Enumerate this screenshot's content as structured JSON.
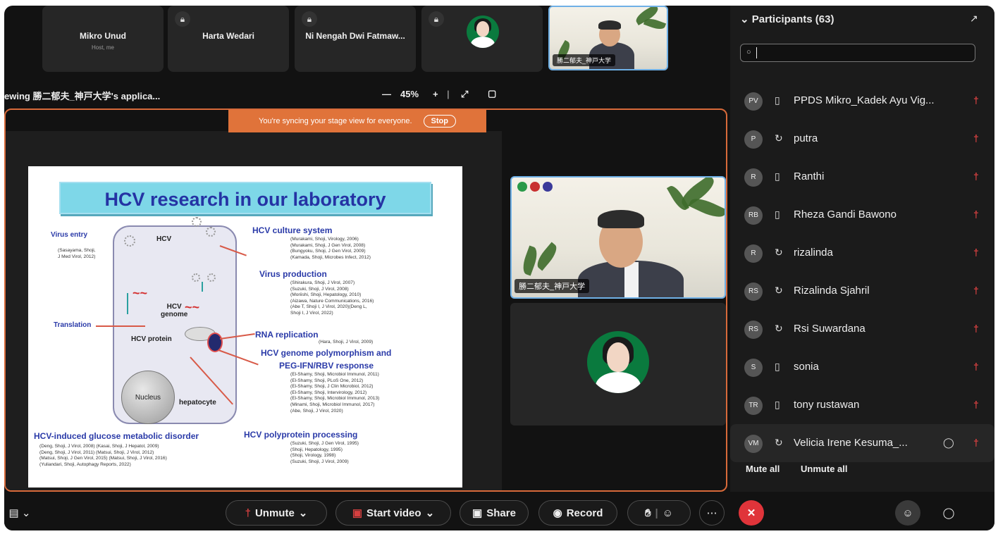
{
  "top_tiles": [
    {
      "name": "Mikro Unud",
      "sub": "Host, me"
    },
    {
      "name": "Harta Wedari"
    },
    {
      "name": "Ni Nengah Dwi Fatmaw..."
    }
  ],
  "speaker_label": "勝二郁夫_神戸大学",
  "share_bar": {
    "text": "ewing 勝二郁夫_神戸大学's applica...",
    "zoom_minus": "—",
    "zoom": "45%",
    "zoom_plus": "+"
  },
  "sync_banner": {
    "text": "You're syncing your stage view for everyone.",
    "stop": "Stop"
  },
  "slide": {
    "title": "HCV research in our laboratory",
    "labels": {
      "virus_entry": "Virus entry",
      "hcv": "HCV",
      "translation": "Translation",
      "hcv_genome": "HCV\ngenome",
      "hcv_protein": "HCV protein",
      "nucleus": "Nucleus",
      "hepatocyte": "hepatocyte",
      "glucose": "HCV-induced glucose metabolic disorder"
    },
    "entry_refs": "(Sasayama, Shoji,\nJ Med Virol, 2012)",
    "glucose_refs": "(Deng, Shoji, J Virol, 2008) (Kasai, Shoji, J Hepatol, 2009)\n(Deng, Shoji, J Virol, 2011) (Matsui, Shoji, J Virol, 2012)\n(Matsui, Shoji, J Gen Virol, 2015) (Matsui, Shoji, J Virol, 2016)\n(Yuliandari, Shoji, Autophagy Reports, 2022)",
    "sections": [
      {
        "heading": "HCV culture system",
        "refs": "(Murakami, Shoji, Virology, 2006)\n(Murakami, Shoji, J Gen Virol, 2008)\n(Bungyoku, Shoji, J Gen Virol, 2009)\n(Kamada, Shoji, Microbes Infect, 2012)"
      },
      {
        "heading": "Virus production",
        "refs": "(Shirakura, Shoji, J Virol, 2007)\n(Suzuki, Shoji, J Virol, 2008)\n(Moriishi, Shoji, Hepatology, 2010)\n(Aizawa, Nature Communications, 2016)\n(Abe T, Shoji I, J Virol, 2020)(Deng L,\nShoji I, J Virol, 2022)"
      },
      {
        "heading": "RNA replication",
        "refs": "(Hara, Shoji, J Virol, 2009)"
      },
      {
        "heading": "HCV genome polymorphism and",
        "heading2": "PEG-IFN/RBV response",
        "refs": "(El-Shamy, Shoji, Microbiol Immunol, 2011)\n(El-Shamy, Shoji, PLoS One, 2012)\n(El-Shamy, Shoji, J Clin Microbiol, 2012)\n(El-Shamy, Shoji, Intervirology, 2012)\n(El-Shamy, Shoji, Microbiol Immunol, 2013)\n(Minami, Shoji, Microbiol Immunol, 2017)\n(Abe, Shoji, J Virol, 2020)"
      },
      {
        "heading": "HCV polyprotein processing",
        "refs": "(Suzuki, Shoji, J Gen Virol, 1995)\n(Shoji, Hepatology, 1995)\n(Shoji, Virology, 1998)\n(Suzuki, Shoji, J Virol, 2009)"
      }
    ]
  },
  "participants": {
    "title": "Participants (63)",
    "rows": [
      {
        "initials": "PV",
        "device": "phone",
        "name": "PPDS Mikro_Kadek Ayu Vig..."
      },
      {
        "initials": "P",
        "device": "web",
        "name": "putra"
      },
      {
        "initials": "R",
        "device": "phone",
        "name": "Ranthi"
      },
      {
        "initials": "RB",
        "device": "phone",
        "name": "Rheza Gandi Bawono"
      },
      {
        "initials": "R",
        "device": "web",
        "name": "rizalinda"
      },
      {
        "initials": "RS",
        "device": "web",
        "name": "Rizalinda Sjahril"
      },
      {
        "initials": "RS",
        "device": "web",
        "name": "Rsi Suwardana"
      },
      {
        "initials": "S",
        "device": "phone",
        "name": "sonia"
      },
      {
        "initials": "TR",
        "device": "phone",
        "name": "tony rustawan"
      },
      {
        "initials": "VM",
        "device": "web",
        "name": "Velicia Irene Kesuma_..."
      }
    ],
    "mute_all": "Mute all",
    "unmute_all": "Unmute all"
  },
  "toolbar": {
    "unmute": "Unmute",
    "start_video": "Start video",
    "share": "Share",
    "record": "Record"
  },
  "colors": {
    "accent": "#e0733a",
    "stage_border": "#d86a3a",
    "leave": "#e0343a",
    "mic_muted": "#d64040"
  }
}
